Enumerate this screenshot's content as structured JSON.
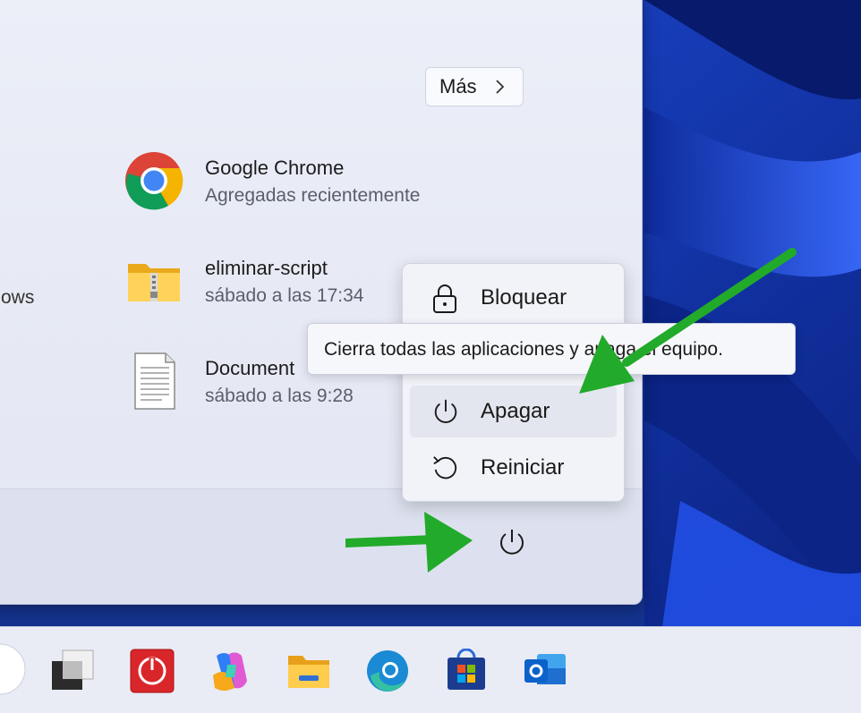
{
  "start_menu": {
    "more_label": "Más",
    "left_partial_text": "ows",
    "recommended": [
      {
        "title": "Google Chrome",
        "subtitle": "Agregadas recientemente",
        "icon": "chrome-icon"
      },
      {
        "title": "eliminar-script",
        "subtitle": "sábado a las 17:34",
        "icon": "zip-folder-icon"
      },
      {
        "title": "Document",
        "subtitle": "sábado a las 9:28",
        "icon": "text-document-icon"
      }
    ],
    "power_icon": "power-icon"
  },
  "power_menu": {
    "items": [
      {
        "label": "Bloquear",
        "icon": "lock-icon"
      },
      {
        "label": "Apagar",
        "icon": "power-icon"
      },
      {
        "label": "Reiniciar",
        "icon": "restart-icon"
      }
    ],
    "tooltip": "Cierra todas las aplicaciones y apaga el equipo."
  },
  "taskbar": {
    "icons": [
      "search-icon",
      "task-view-icon",
      "power-app-icon",
      "copilot-icon",
      "file-explorer-icon",
      "edge-icon",
      "microsoft-store-icon",
      "outlook-icon"
    ]
  },
  "colors": {
    "annotation_arrow": "#22aa2a",
    "wallpaper_blue": "#0a2fa8"
  }
}
